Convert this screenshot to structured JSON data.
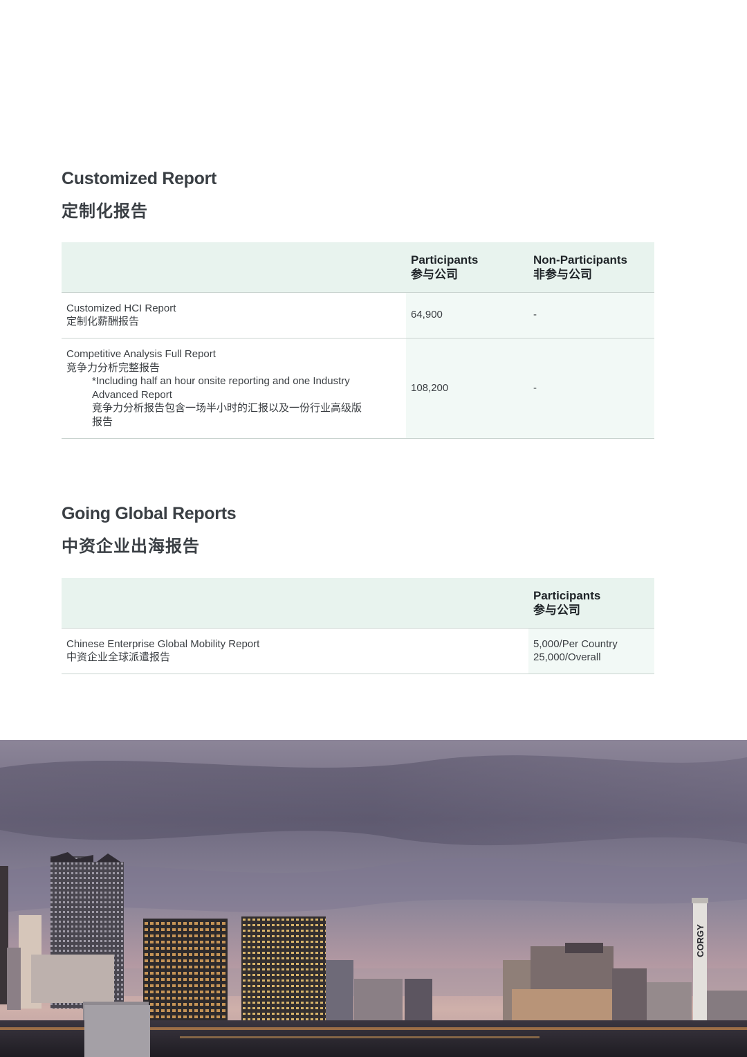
{
  "customized": {
    "title_en": "Customized Report",
    "title_cn": "定制化报告",
    "header": {
      "col1_en": "Participants",
      "col1_cn": "参与公司",
      "col2_en": "Non-Participants",
      "col2_cn": "非参与公司"
    },
    "rows": [
      {
        "name_en": "Customized HCI Report",
        "name_cn": "定制化薪酬报告",
        "participants": "64,900",
        "non_participants": "-"
      },
      {
        "name_en": "Competitive Analysis Full Report",
        "name_cn": "竞争力分析完整报告",
        "note_en_1": "*Including half an hour onsite reporting and one Industry",
        "note_en_2": "Advanced Report",
        "note_cn_1": "竞争力分析报告包含一场半小时的汇报以及一份行业高级版",
        "note_cn_2": "报告",
        "participants": "108,200",
        "non_participants": "-"
      }
    ]
  },
  "global": {
    "title_en": "Going Global Reports",
    "title_cn": "中资企业出海报告",
    "header": {
      "col1_en": "Participants",
      "col1_cn": "参与公司"
    },
    "rows": [
      {
        "name_en": "Chinese Enterprise Global Mobility Report",
        "name_cn": "中资企业全球派遣报告",
        "price_1": "5,000/Per Country",
        "price_2": "25,000/Overall"
      }
    ]
  },
  "photo": {
    "tower_text": "CORGY"
  }
}
